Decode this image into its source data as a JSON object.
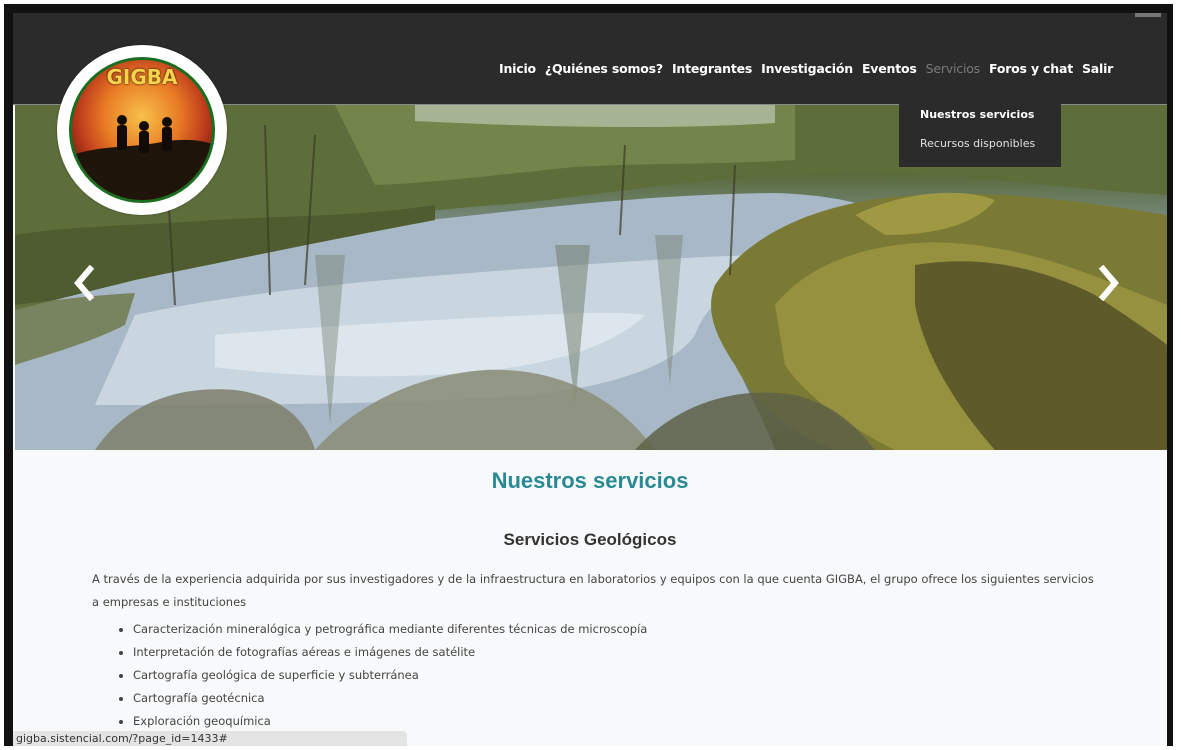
{
  "logo": {
    "text": "GIGBA",
    "alt_name": "GIGBA logo"
  },
  "nav": {
    "items": [
      {
        "label": "Inicio"
      },
      {
        "label": "¿Quiénes somos?"
      },
      {
        "label": "Integrantes"
      },
      {
        "label": "Investigación"
      },
      {
        "label": "Eventos"
      },
      {
        "label": "Servicios",
        "active": true
      },
      {
        "label": "Foros y chat"
      },
      {
        "label": "Salir"
      }
    ]
  },
  "dropdown": {
    "items": [
      {
        "label": "Nuestros servicios"
      },
      {
        "label": "Recursos disponibles"
      }
    ]
  },
  "hero": {
    "prev_icon": "chevron-left-icon",
    "next_icon": "chevron-right-icon"
  },
  "content": {
    "title": "Nuestros servicios",
    "subtitle": "Servicios Geológicos",
    "paragraph": "A través de la experiencia adquirida por sus investigadores y de la infraestructura en laboratorios y equipos con la que cuenta GIGBA, el grupo ofrece los siguientes servicios a empresas e instituciones",
    "list": [
      "Caracterización mineralógica y petrográfica mediante diferentes técnicas de microscopía",
      "Interpretación de fotografías aéreas e imágenes de satélite",
      "Cartografía geológica de superficie y subterránea",
      "Cartografía geotécnica",
      "Exploración geoquímica"
    ]
  },
  "status": {
    "url": "gigba.sistencial.com/?page_id=1433#"
  },
  "colors": {
    "header_bg": "#2b2b2b",
    "title": "#2a8a93",
    "page_bg": "#f8f9fa"
  }
}
